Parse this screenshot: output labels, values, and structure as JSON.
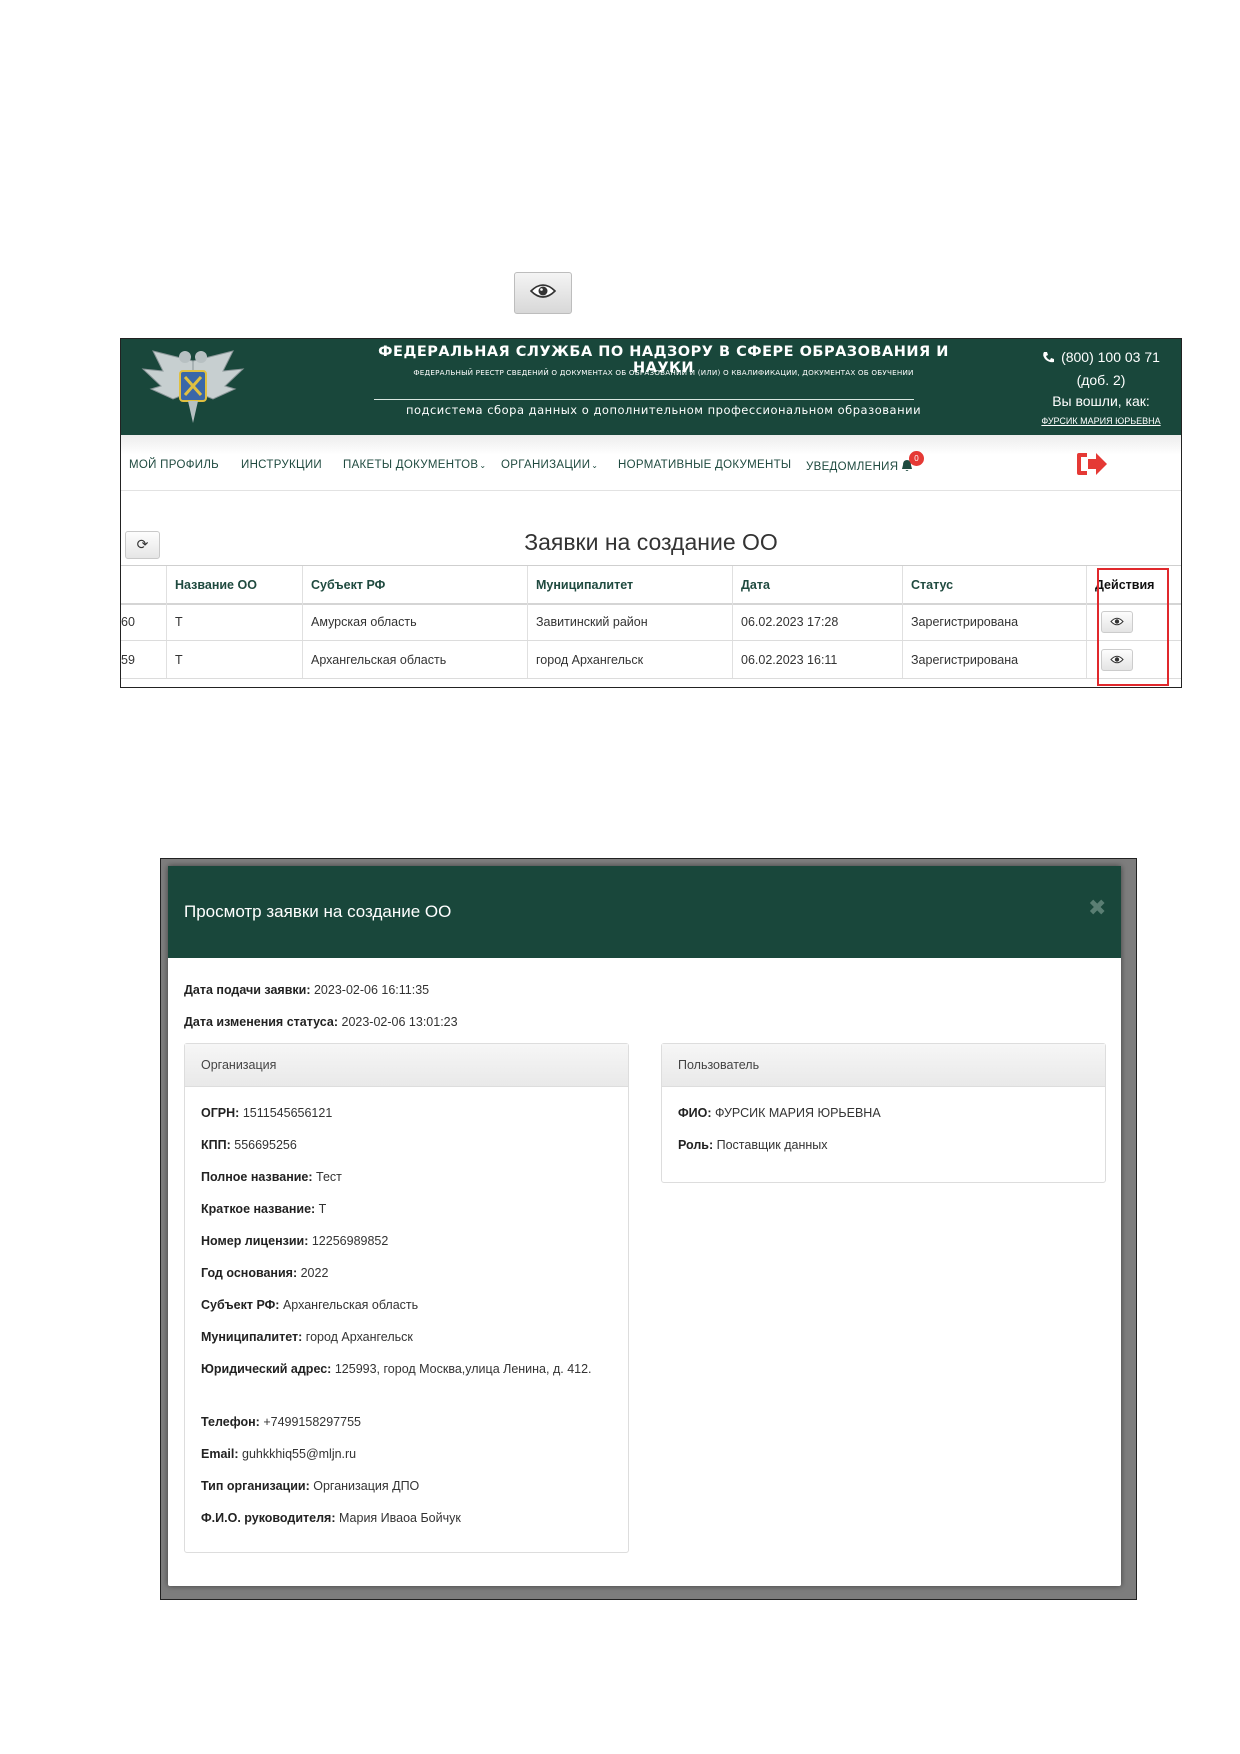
{
  "illustration": {
    "icon": "eye-icon"
  },
  "screen1": {
    "header": {
      "title": "ФЕДЕРАЛЬНАЯ СЛУЖБА ПО НАДЗОРУ В СФЕРЕ ОБРАЗОВАНИЯ И НАУКИ",
      "subtitle": "ФЕДЕРАЛЬНЫЙ РЕЕСТР СВЕДЕНИЙ О ДОКУМЕНТАХ ОБ ОБРАЗОВАНИИ И (ИЛИ) О КВАЛИФИКАЦИИ, ДОКУМЕНТАХ ОБ ОБУЧЕНИИ",
      "system": "подсистема сбора данных о дополнительном профессиональном образовании",
      "phone": "(800) 100 03 71",
      "ext": "(доб. 2)",
      "logged_in": "Вы вошли, как:",
      "user": "ФУРСИК МАРИЯ ЮРЬЕВНА"
    },
    "nav": {
      "profile": "МОЙ ПРОФИЛЬ",
      "instructions": "ИНСТРУКЦИИ",
      "packages": "ПАКЕТЫ ДОКУМЕНТОВ",
      "organizations": "ОРГАНИЗАЦИИ",
      "normative": "НОРМАТИВНЫЕ ДОКУМЕНТЫ",
      "notifications": "УВЕДОМЛЕНИЯ",
      "notifications_count": "0"
    },
    "page_title": "Заявки на создание ОО",
    "table": {
      "headers": [
        "",
        "Название ОО",
        "Субъект РФ",
        "Муниципалитет",
        "Дата",
        "Статус",
        "Действия"
      ],
      "rows": [
        [
          "60",
          "Т",
          "Амурская область",
          "Завитинский район",
          "06.02.2023 17:28",
          "Зарегистрирована"
        ],
        [
          "59",
          "Т",
          "Архангельская область",
          "город Архангельск",
          "06.02.2023 16:11",
          "Зарегистрирована"
        ]
      ]
    }
  },
  "screen2": {
    "modal_title": "Просмотр заявки на создание ОО",
    "submitted_label": "Дата подачи заявки:",
    "submitted_value": "2023-02-06 16:11:35",
    "status_changed_label": "Дата изменения статуса:",
    "status_changed_value": "2023-02-06 13:01:23",
    "org_panel": {
      "title": "Организация",
      "fields": [
        {
          "label": "ОГРН:",
          "value": "1511545656121"
        },
        {
          "label": "КПП:",
          "value": "556695256"
        },
        {
          "label": "Полное название:",
          "value": "Тест"
        },
        {
          "label": "Краткое название:",
          "value": "Т"
        },
        {
          "label": "Номер лицензии:",
          "value": "12256989852"
        },
        {
          "label": "Год основания:",
          "value": "2022"
        },
        {
          "label": "Субъект РФ:",
          "value": "Архангельская область"
        },
        {
          "label": "Муниципалитет:",
          "value": "город Архангельск"
        },
        {
          "label": "Юридический адрес:",
          "value": "125993, город Москва,улица Ленина, д. 412."
        },
        {
          "label": "Телефон:",
          "value": "+7499158297755"
        },
        {
          "label": "Email:",
          "value": "guhkkhiq55@mljn.ru"
        },
        {
          "label": "Тип организации:",
          "value": "Организация ДПО"
        },
        {
          "label": "Ф.И.О. руководителя:",
          "value": "Мария Иваоа Бойчук"
        }
      ]
    },
    "user_panel": {
      "title": "Пользователь",
      "fields": [
        {
          "label": "ФИО:",
          "value": "ФУРСИК МАРИЯ ЮРЬЕВНА"
        },
        {
          "label": "Роль:",
          "value": "Поставщик данных"
        }
      ]
    }
  },
  "colors": {
    "header_green": "#19473b",
    "highlight_red": "#e0282c",
    "badge_red": "#e53935",
    "logout_red": "#e53935"
  }
}
